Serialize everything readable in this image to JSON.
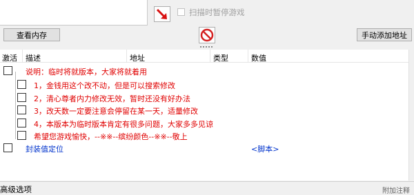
{
  "top": {
    "pause_label": "扫描时暂停游戏"
  },
  "buttons": {
    "view_memory": "查看内存",
    "add_address": "手动添加地址"
  },
  "columns": [
    "激活",
    "描述",
    "地址",
    "类型",
    "数值"
  ],
  "rows": [
    {
      "text": "说明：临时将就版本，大家将就着用",
      "color": "#e00000"
    },
    {
      "text": "1，金钱用这个改不动，但是可以搜索修改",
      "color": "#e00000"
    },
    {
      "text": "2，清心尊者内力修改无效，暂时还没有好办法",
      "color": "#e00000"
    },
    {
      "text": "3，改天数一定要注意会停留在某一天，适量修改",
      "color": "#e00000"
    },
    {
      "text": "4，本版本为临时版本肯定有很多问题，大家多多见谅",
      "color": "#e00000"
    },
    {
      "text": "希望您游戏愉快，--※※--缤纷颜色--※※--敬上",
      "color": "#e00000"
    },
    {
      "text": "封装值定位",
      "color": "#0033cc",
      "value": "<脚本>"
    }
  ],
  "status": {
    "advanced": "高级选项",
    "right": "附加注释"
  }
}
